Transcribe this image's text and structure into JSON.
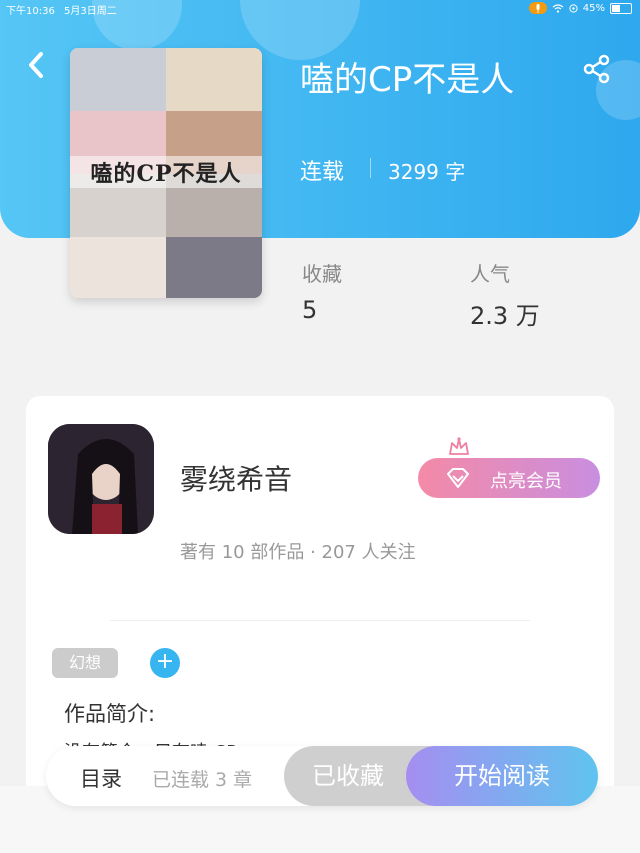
{
  "status_bar": {
    "time": "下午10:36",
    "date": "5月3日周二",
    "battery": "45%"
  },
  "book": {
    "title": "嗑的CP不是人",
    "cover_title": "嗑的CP不是人",
    "status": "连载",
    "word_count": "3299 字",
    "stats": [
      {
        "label": "收藏",
        "value": "5"
      },
      {
        "label": "人气",
        "value": "2.3 万"
      }
    ]
  },
  "author": {
    "name": "雾绕希音",
    "vip_label": "点亮会员",
    "stats": "著有 10 部作品 · 207 人关注"
  },
  "tags": [
    {
      "label": "幻想"
    }
  ],
  "add_tag_label": "+",
  "intro": {
    "title": "作品简介:",
    "body": "没有简介，只有嗑 CP"
  },
  "bottom_bar": {
    "toc_label": "目录",
    "chapters_label": "已连载 3 章",
    "collected_label": "已收藏",
    "start_label": "开始阅读"
  },
  "colors": {
    "header": "#2ea8ee",
    "accent_blue": "#36b5f0",
    "vip_gradient_start": "#f48aa6",
    "vip_gradient_end": "#c98ee0"
  },
  "icons": {
    "back": "chevron-left-icon",
    "share": "share-icon",
    "vip": "diamond-icon",
    "crown": "crown-icon"
  }
}
